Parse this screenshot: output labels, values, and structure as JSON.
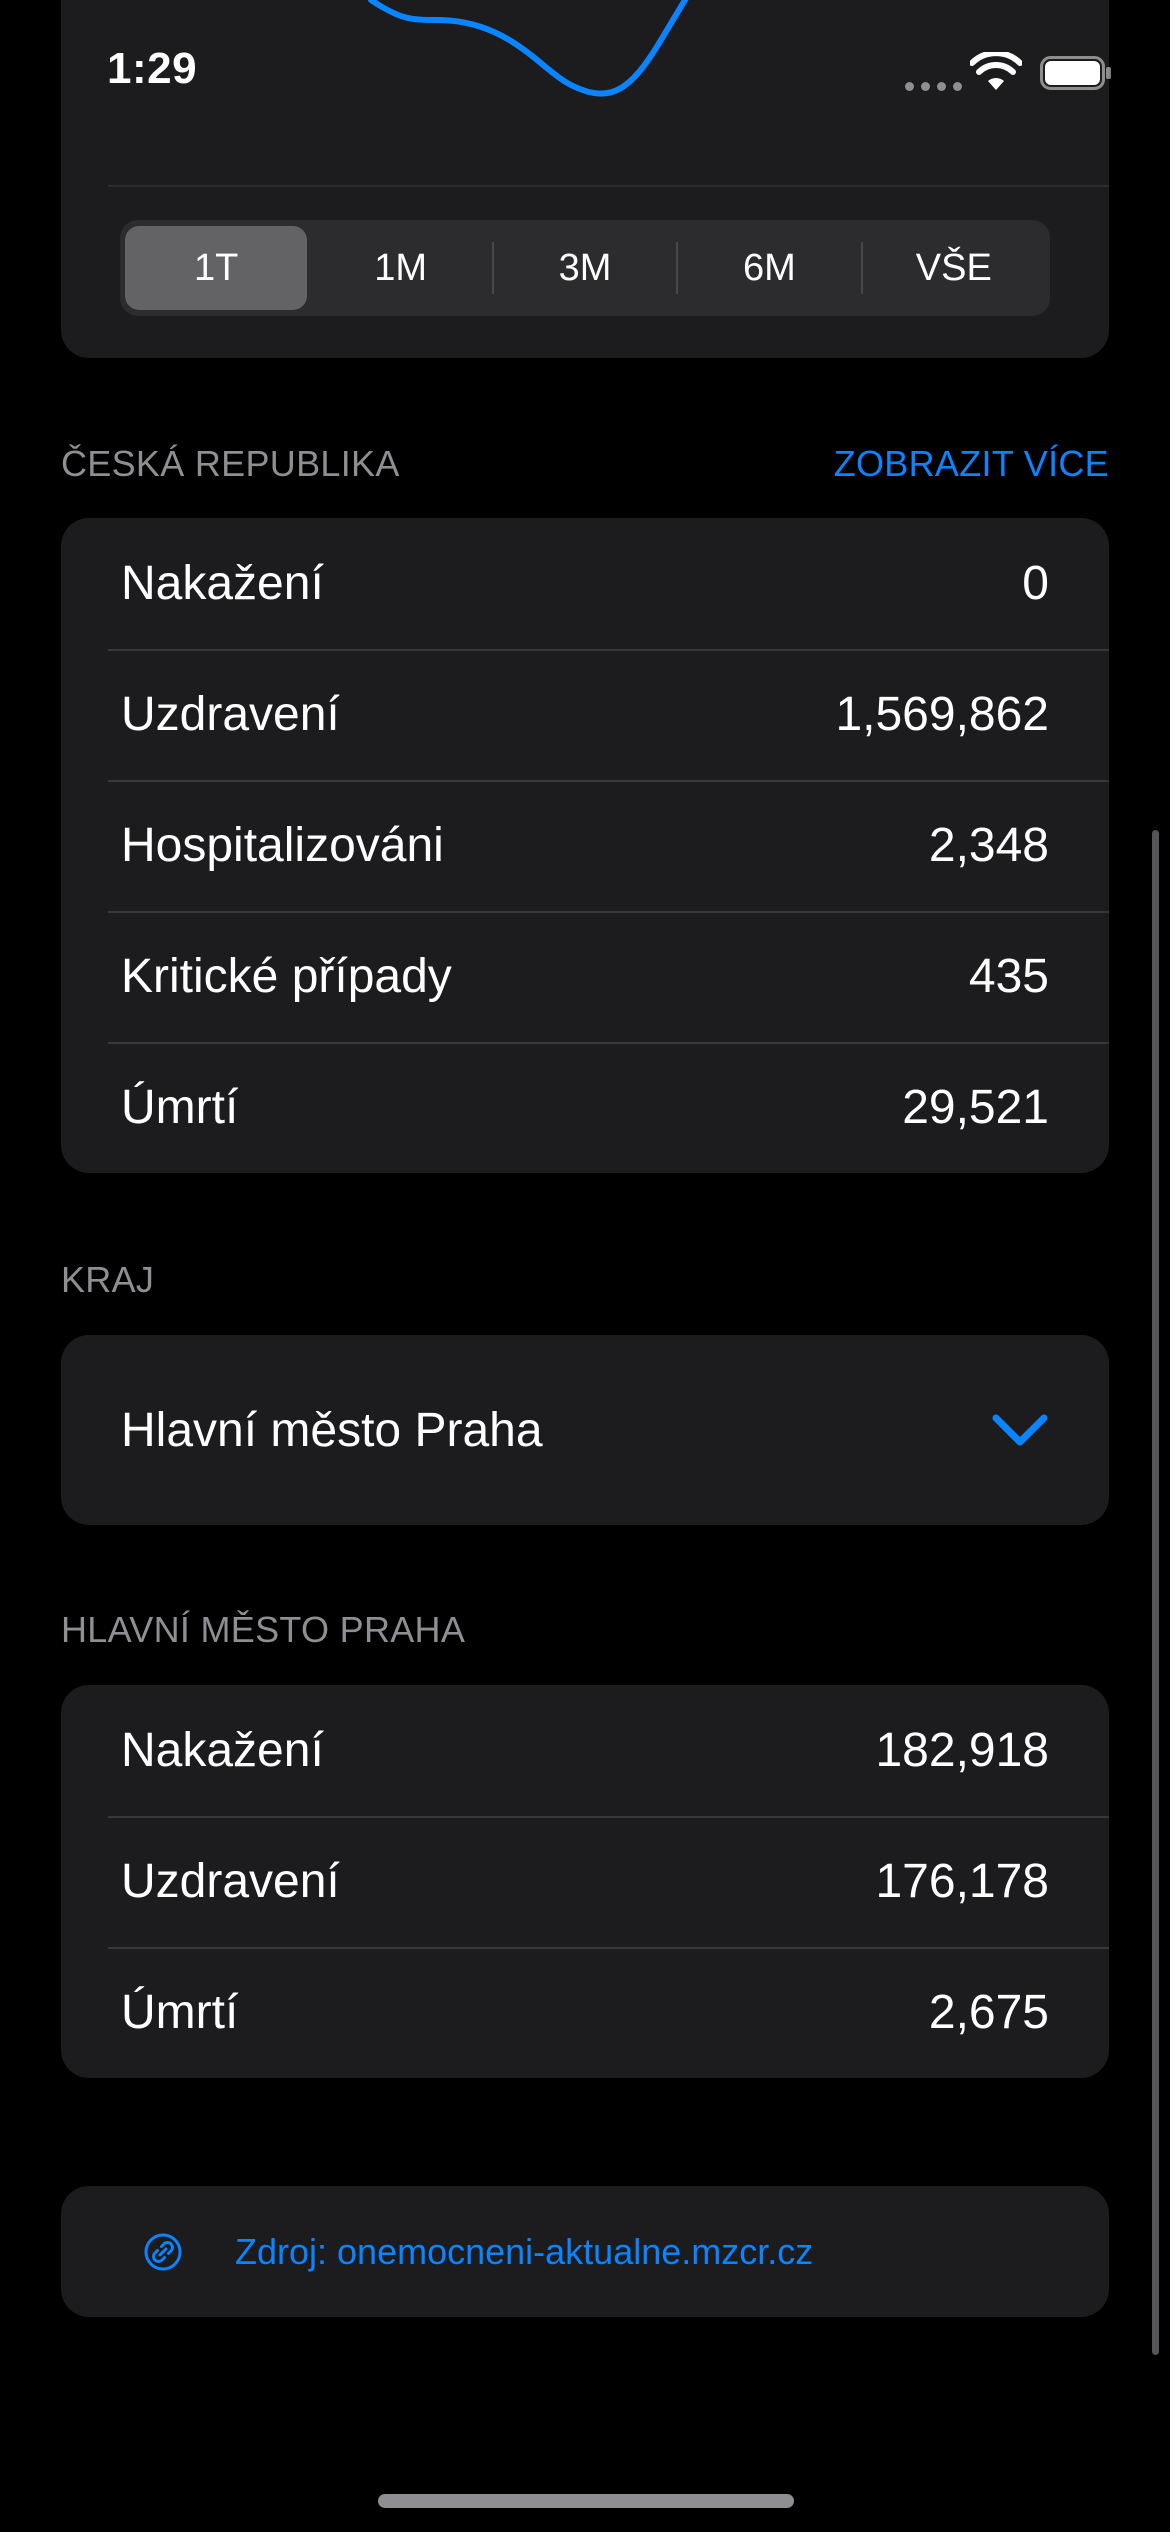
{
  "status_bar": {
    "time": "1:29"
  },
  "chart": {
    "ranges": [
      "1T",
      "1M",
      "3M",
      "6M",
      "VŠE"
    ],
    "selected_range": "1T",
    "line_color": "#0a84ff"
  },
  "czech_republic": {
    "header": "ČESKÁ REPUBLIKA",
    "more_link": "ZOBRAZIT VÍCE",
    "rows": [
      {
        "label": "Nakažení",
        "value": "0"
      },
      {
        "label": "Uzdravení",
        "value": "1,569,862"
      },
      {
        "label": "Hospitalizováni",
        "value": "2,348"
      },
      {
        "label": "Kritické případy",
        "value": "435"
      },
      {
        "label": "Úmrtí",
        "value": "29,521"
      }
    ]
  },
  "region_picker": {
    "header": "KRAJ",
    "selected_region": "Hlavní město Praha",
    "chevron_icon": "chevron-down-icon"
  },
  "region_stats": {
    "header": "HLAVNÍ MĚSTO PRAHA",
    "rows": [
      {
        "label": "Nakažení",
        "value": "182,918"
      },
      {
        "label": "Uzdravení",
        "value": "176,178"
      },
      {
        "label": "Úmrtí",
        "value": "2,675"
      }
    ]
  },
  "source": {
    "icon": "link-icon",
    "text": "Zdroj: onemocneni-aktualne.mzcr.cz"
  },
  "colors": {
    "background": "#000000",
    "card": "#1c1c1e",
    "accent": "#0a84ff",
    "secondary_text": "#8e8e93"
  }
}
